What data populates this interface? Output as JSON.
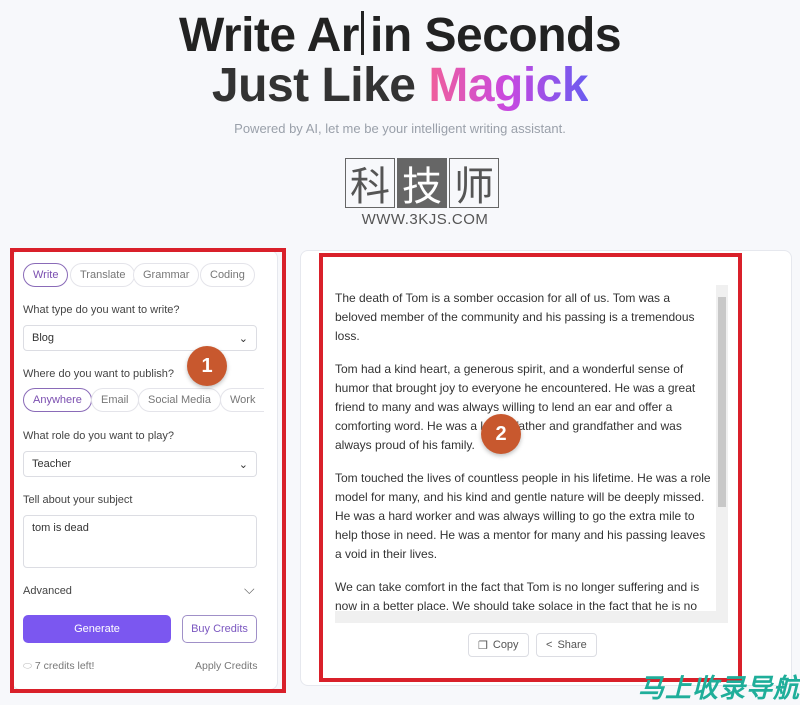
{
  "hero": {
    "line1_a": "Write Ar",
    "line1_b": "in Seconds",
    "line2_a": "Just Like ",
    "line2_b": "Magick",
    "subtitle": "Powered by AI, let me be your intelligent writing assistant."
  },
  "watermark": {
    "chars": [
      "科",
      "技",
      "师"
    ],
    "url": "WWW.3KJS.COM",
    "bottom": "马上收录导航"
  },
  "form": {
    "tabs": [
      {
        "label": "Write",
        "active": true
      },
      {
        "label": "Translate"
      },
      {
        "label": "Grammar"
      },
      {
        "label": "Coding"
      }
    ],
    "type_label": "What type do you want to write?",
    "type_value": "Blog",
    "publish_label": "Where do you want to publish?",
    "publish_options": [
      {
        "label": "Anywhere",
        "active": true
      },
      {
        "label": "Email"
      },
      {
        "label": "Social Media"
      },
      {
        "label": "Work"
      }
    ],
    "role_label": "What role do you want to play?",
    "role_value": "Teacher",
    "subject_label": "Tell about your subject",
    "subject_value": "tom is dead",
    "advanced_label": "Advanced",
    "generate_label": "Generate",
    "buy_label": "Buy Credits",
    "credits_text": "7 credits left!",
    "apply_label": "Apply Credits"
  },
  "output": {
    "paragraphs": [
      "The death of Tom is a somber occasion for all of us. Tom was a beloved member of the community and his passing is a tremendous loss.",
      "Tom had a kind heart, a generous spirit, and a wonderful sense of humor that brought joy to everyone he encountered. He was a great friend to many and was always willing to lend an ear and offer a comforting word. He was a loving father and grandfather and was always proud of his family.",
      "Tom touched the lives of countless people in his lifetime. He was a role model for many, and his kind and gentle nature will be deeply missed. He was a hard worker and was always willing to go the extra mile to help those in need. He was a mentor for many and his passing leaves a void in their lives.",
      "We can take comfort in the fact that Tom is no longer suffering and is now in a better place. We should take solace in the fact that he is no longer in pain and can now rest peacefully."
    ],
    "copy_label": "Copy",
    "share_label": "Share"
  },
  "annotations": {
    "badge1": "1",
    "badge2": "2",
    "highlight_color": "#d9202a"
  },
  "colors": {
    "primary": "#7b57f0",
    "badge": "#c8582e"
  }
}
